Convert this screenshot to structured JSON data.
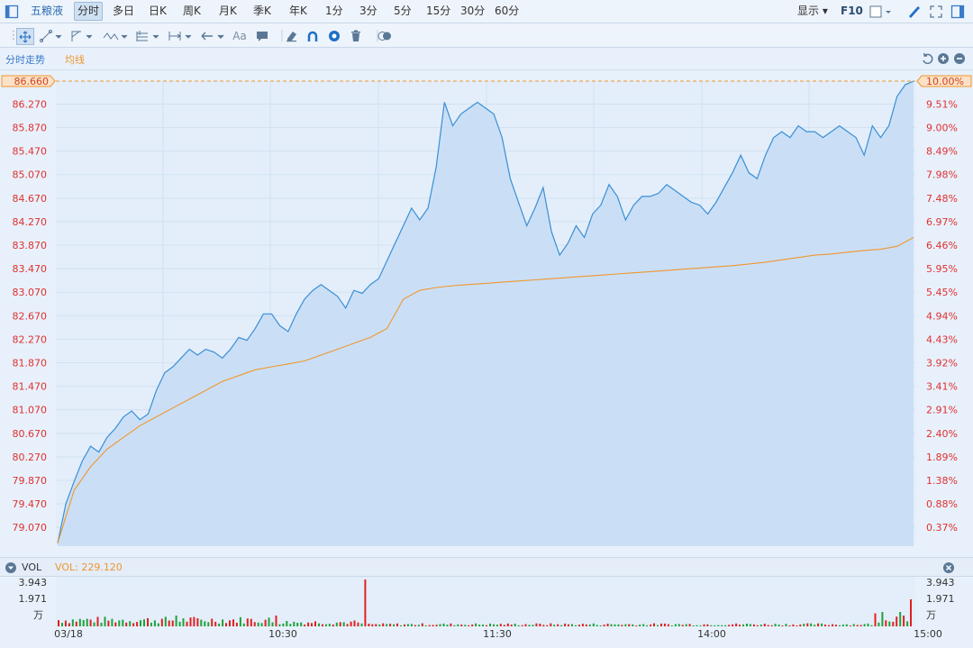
{
  "toolbar": {
    "stock_name": "五粮液",
    "periods": [
      "分时",
      "多日",
      "日K",
      "周K",
      "月K",
      "季K",
      "年K",
      "1分",
      "3分",
      "5分",
      "15分",
      "30分",
      "60分"
    ],
    "active_period": "分时",
    "display_label": "显示",
    "f10_label": "F10",
    "text_tool_label": "Aa"
  },
  "subbar": {
    "mode_label": "分时走势",
    "avg_label": "均线"
  },
  "price_axis": [
    "86.660",
    "86.270",
    "85.870",
    "85.470",
    "85.070",
    "84.670",
    "84.270",
    "83.870",
    "83.470",
    "83.070",
    "82.670",
    "82.270",
    "81.870",
    "81.470",
    "81.070",
    "80.670",
    "80.270",
    "79.870",
    "79.470",
    "79.070"
  ],
  "pct_axis": [
    "10.00%",
    "9.51%",
    "9.00%",
    "8.49%",
    "7.98%",
    "7.48%",
    "6.97%",
    "6.46%",
    "5.95%",
    "5.45%",
    "4.94%",
    "4.43%",
    "3.92%",
    "3.41%",
    "2.91%",
    "2.40%",
    "1.89%",
    "1.38%",
    "0.88%",
    "0.37%"
  ],
  "volume": {
    "header_label": "VOL",
    "value_label": "VOL: 229.120",
    "axis": [
      "3.943",
      "1.971",
      "万"
    ]
  },
  "time_axis": [
    "03/18",
    "10:30",
    "11:30",
    "14:00",
    "15:00"
  ],
  "colors": {
    "price_line": "#3a8fd6",
    "avg_line": "#f0962e",
    "up": "#e02020",
    "down": "#1ca23b",
    "axis_red": "#e03030",
    "ref_line": "#f0962e"
  },
  "chart_data": {
    "type": "line",
    "series": [
      {
        "name": "分时走势",
        "values": [
          78.8,
          79.47,
          79.85,
          80.2,
          80.45,
          80.35,
          80.6,
          80.75,
          80.95,
          81.05,
          80.9,
          81.0,
          81.4,
          81.7,
          81.8,
          81.95,
          82.1,
          82.0,
          82.1,
          82.05,
          81.95,
          82.1,
          82.3,
          82.25,
          82.45,
          82.7,
          82.7,
          82.5,
          82.4,
          82.7,
          82.95,
          83.1,
          83.2,
          83.1,
          83.0,
          82.8,
          83.1,
          83.05,
          83.2,
          83.3,
          83.6,
          83.9,
          84.2,
          84.5,
          84.3,
          84.5,
          85.2,
          86.3,
          85.9,
          86.1,
          86.2,
          86.3,
          86.2,
          86.1,
          85.7,
          85.0,
          84.6,
          84.2,
          84.5,
          84.85,
          84.1,
          83.7,
          83.9,
          84.2,
          84.0,
          84.4,
          84.55,
          84.9,
          84.7,
          84.3,
          84.55,
          84.7,
          84.7,
          84.75,
          84.9,
          84.8,
          84.7,
          84.6,
          84.55,
          84.4,
          84.6,
          84.85,
          85.1,
          85.4,
          85.1,
          85.0,
          85.4,
          85.7,
          85.8,
          85.7,
          85.9,
          85.8,
          85.8,
          85.7,
          85.8,
          85.9,
          85.8,
          85.7,
          85.4,
          85.9,
          85.7,
          85.9,
          86.4,
          86.6,
          86.66
        ]
      },
      {
        "name": "均线",
        "values": [
          78.8,
          79.7,
          80.1,
          80.4,
          80.6,
          80.8,
          80.95,
          81.1,
          81.25,
          81.4,
          81.55,
          81.65,
          81.75,
          81.8,
          81.85,
          81.9,
          82.0,
          82.1,
          82.2,
          82.3,
          82.45,
          82.95,
          83.1,
          83.15,
          83.18,
          83.2,
          83.22,
          83.24,
          83.26,
          83.28,
          83.3,
          83.32,
          83.34,
          83.36,
          83.38,
          83.4,
          83.42,
          83.44,
          83.46,
          83.48,
          83.5,
          83.52,
          83.55,
          83.58,
          83.62,
          83.66,
          83.7,
          83.72,
          83.75,
          83.78,
          83.8,
          83.85,
          84.0
        ]
      }
    ],
    "ylim": [
      78.75,
      86.66
    ],
    "reference_price": 86.66,
    "volume_ylim": [
      0,
      3.943
    ],
    "volume_unit": "万"
  }
}
